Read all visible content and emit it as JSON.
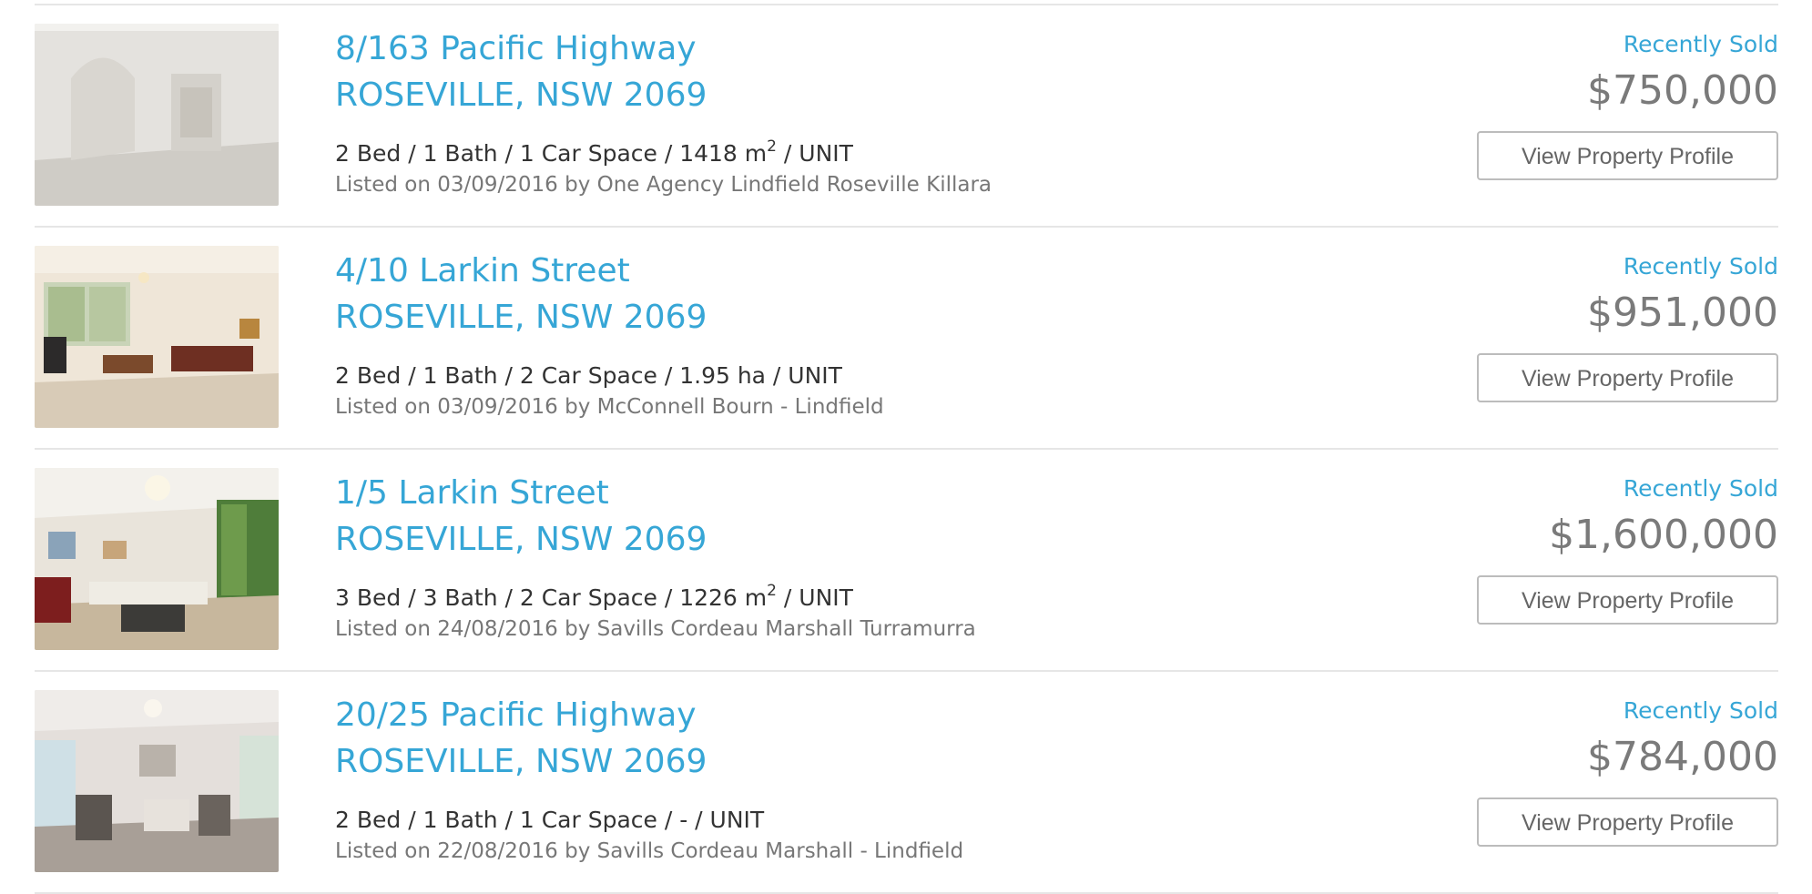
{
  "listings": [
    {
      "address_line1": "8/163 Pacific Highway",
      "address_line2": "ROSEVILLE, NSW 2069",
      "features_before": "2 Bed / 1 Bath / 1 Car Space / 1418 m",
      "features_sup": "2",
      "features_after": " / UNIT",
      "listed": "Listed on 03/09/2016 by One Agency Lindfield Roseville Killara",
      "status": "Recently Sold",
      "price": "$750,000",
      "button_label": "View Property Profile"
    },
    {
      "address_line1": "4/10 Larkin Street",
      "address_line2": "ROSEVILLE, NSW 2069",
      "features_before": "2 Bed / 1 Bath / 2 Car Space / 1.95 ha / UNIT",
      "features_sup": "",
      "features_after": "",
      "listed": "Listed on 03/09/2016 by McConnell Bourn - Lindfield",
      "status": "Recently Sold",
      "price": "$951,000",
      "button_label": "View Property Profile"
    },
    {
      "address_line1": "1/5 Larkin Street",
      "address_line2": "ROSEVILLE, NSW 2069",
      "features_before": "3 Bed / 3 Bath / 2 Car Space / 1226 m",
      "features_sup": "2",
      "features_after": " / UNIT",
      "listed": "Listed on 24/08/2016 by Savills Cordeau Marshall Turramurra",
      "status": "Recently Sold",
      "price": "$1,600,000",
      "button_label": "View Property Profile"
    },
    {
      "address_line1": "20/25 Pacific Highway",
      "address_line2": "ROSEVILLE, NSW 2069",
      "features_before": "2 Bed / 1 Bath / 1 Car Space / - / UNIT",
      "features_sup": "",
      "features_after": "",
      "listed": "Listed on 22/08/2016 by Savills Cordeau Marshall - Lindfield",
      "status": "Recently Sold",
      "price": "$784,000",
      "button_label": "View Property Profile"
    }
  ],
  "colors": {
    "link": "#36a6d6",
    "price": "#7a7a7a",
    "divider": "#e6e6e6"
  }
}
